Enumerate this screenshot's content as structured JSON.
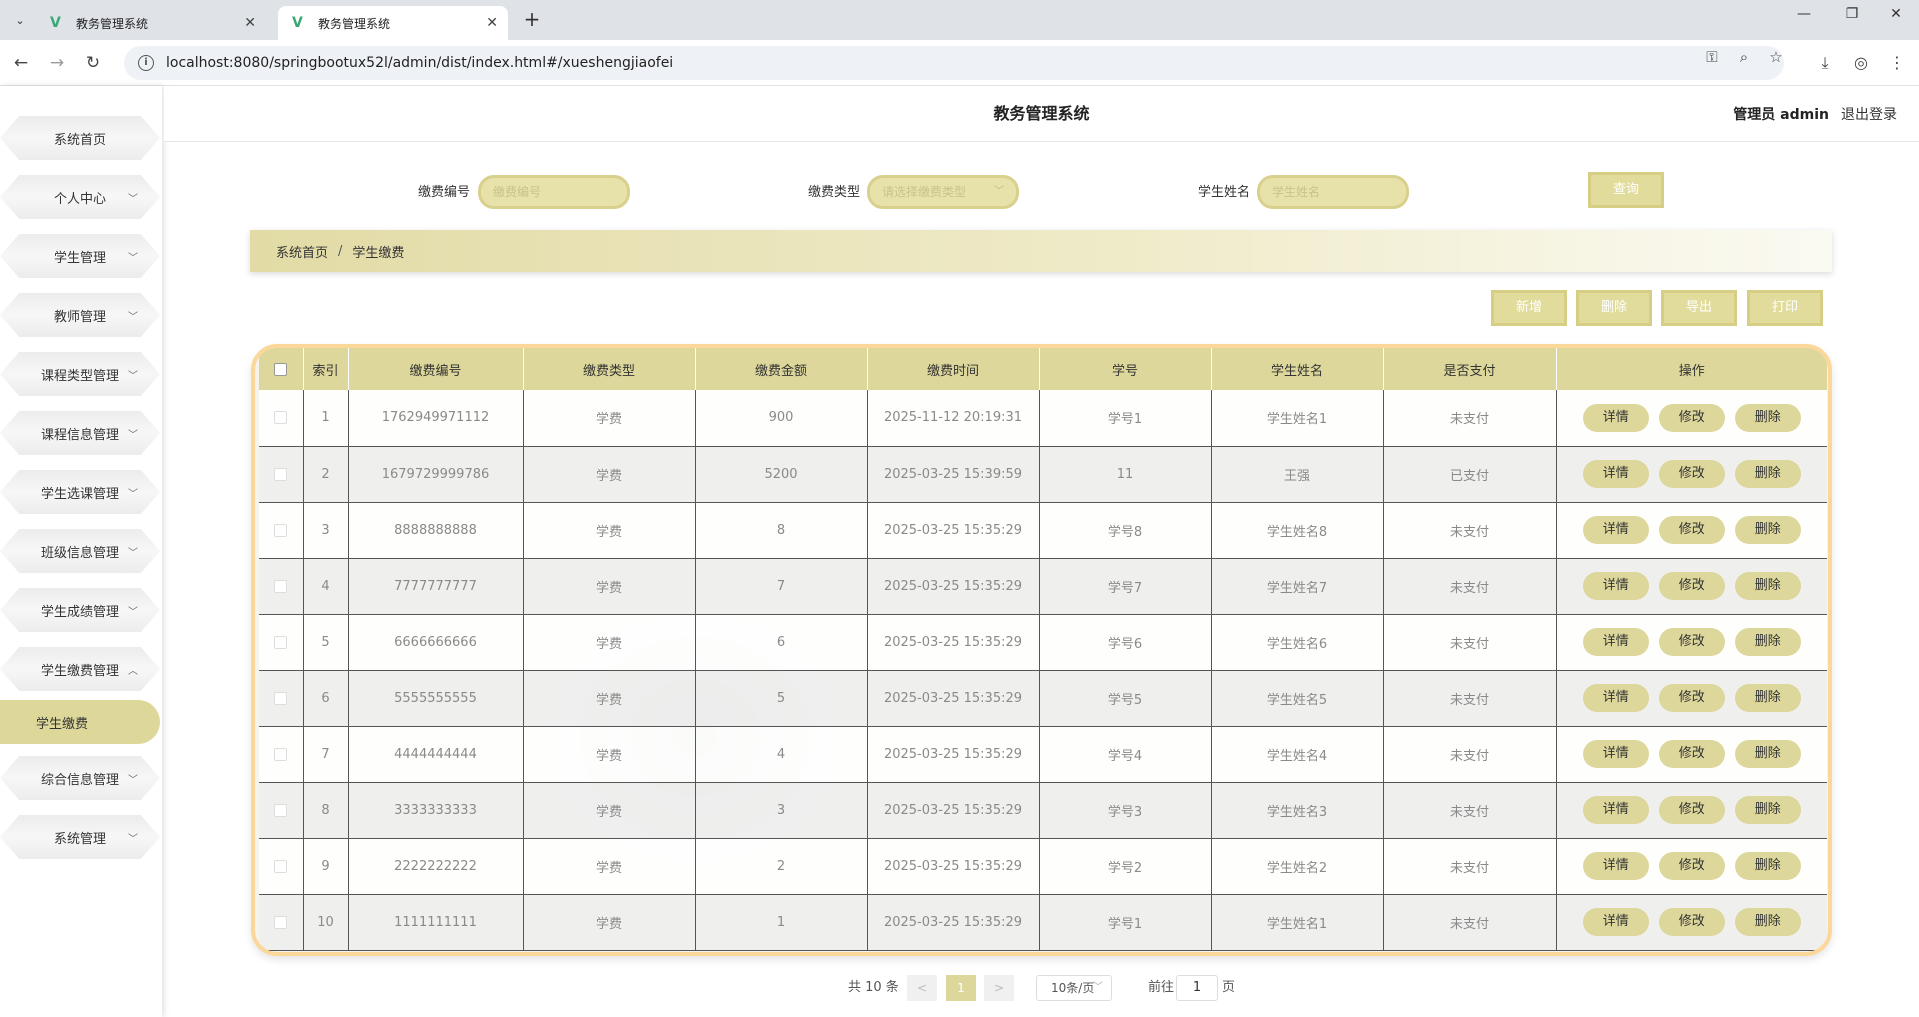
{
  "browser": {
    "tabs": [
      {
        "title": "教务管理系统",
        "active": false
      },
      {
        "title": "教务管理系统",
        "active": true
      }
    ],
    "url": "localhost:8080/springbootux52l/admin/dist/index.html#/xueshengjiaofei"
  },
  "header": {
    "title": "教务管理系统",
    "user": "管理员 admin",
    "logout": "退出登录"
  },
  "sidebar": {
    "items": [
      {
        "label": "系统首页",
        "chevron": ""
      },
      {
        "label": "个人中心",
        "chevron": "﹀"
      },
      {
        "label": "学生管理",
        "chevron": "﹀"
      },
      {
        "label": "教师管理",
        "chevron": "﹀"
      },
      {
        "label": "课程类型管理",
        "chevron": "﹀"
      },
      {
        "label": "课程信息管理",
        "chevron": "﹀"
      },
      {
        "label": "学生选课管理",
        "chevron": "﹀"
      },
      {
        "label": "班级信息管理",
        "chevron": "﹀"
      },
      {
        "label": "学生成绩管理",
        "chevron": "﹀"
      },
      {
        "label": "学生缴费管理",
        "chevron": "︿"
      },
      {
        "label": "学生缴费",
        "chevron": ""
      },
      {
        "label": "综合信息管理",
        "chevron": "﹀"
      },
      {
        "label": "系统管理",
        "chevron": "﹀"
      }
    ]
  },
  "filters": {
    "fee_no_label": "缴费编号",
    "fee_no_placeholder": "缴费编号",
    "fee_type_label": "缴费类型",
    "fee_type_placeholder": "请选择缴费类型",
    "student_name_label": "学生姓名",
    "student_name_placeholder": "学生姓名",
    "query_label": "查询"
  },
  "breadcrumb": {
    "home": "系统首页",
    "sep": "/",
    "current": "学生缴费"
  },
  "actions": {
    "add": "新增",
    "delete": "删除",
    "export": "导出",
    "print": "打印"
  },
  "table": {
    "columns": [
      "索引",
      "缴费编号",
      "缴费类型",
      "缴费金额",
      "缴费时间",
      "学号",
      "学生姓名",
      "是否支付",
      "操作"
    ],
    "op_labels": {
      "detail": "详情",
      "edit": "修改",
      "delete": "删除"
    },
    "rows": [
      [
        "1",
        "1762949971112",
        "学费",
        "900",
        "2025-11-12 20:19:31",
        "学号1",
        "学生姓名1",
        "未支付"
      ],
      [
        "2",
        "1679729999786",
        "学费",
        "5200",
        "2025-03-25 15:39:59",
        "11",
        "王强",
        "已支付"
      ],
      [
        "3",
        "8888888888",
        "学费",
        "8",
        "2025-03-25 15:35:29",
        "学号8",
        "学生姓名8",
        "未支付"
      ],
      [
        "4",
        "7777777777",
        "学费",
        "7",
        "2025-03-25 15:35:29",
        "学号7",
        "学生姓名7",
        "未支付"
      ],
      [
        "5",
        "6666666666",
        "学费",
        "6",
        "2025-03-25 15:35:29",
        "学号6",
        "学生姓名6",
        "未支付"
      ],
      [
        "6",
        "5555555555",
        "学费",
        "5",
        "2025-03-25 15:35:29",
        "学号5",
        "学生姓名5",
        "未支付"
      ],
      [
        "7",
        "4444444444",
        "学费",
        "4",
        "2025-03-25 15:35:29",
        "学号4",
        "学生姓名4",
        "未支付"
      ],
      [
        "8",
        "3333333333",
        "学费",
        "3",
        "2025-03-25 15:35:29",
        "学号3",
        "学生姓名3",
        "未支付"
      ],
      [
        "9",
        "2222222222",
        "学费",
        "2",
        "2025-03-25 15:35:29",
        "学号2",
        "学生姓名2",
        "未支付"
      ],
      [
        "10",
        "1111111111",
        "学费",
        "1",
        "2025-03-25 15:35:29",
        "学号1",
        "学生姓名1",
        "未支付"
      ]
    ]
  },
  "pagination": {
    "total": "共 10 条",
    "prev": "<",
    "current": "1",
    "next": ">",
    "page_size": "10条/页",
    "goto_label": "前往",
    "goto_value": "1",
    "page_unit": "页"
  },
  "colors": {
    "accent": "#ddd79b",
    "table_border": "#fbd799"
  }
}
